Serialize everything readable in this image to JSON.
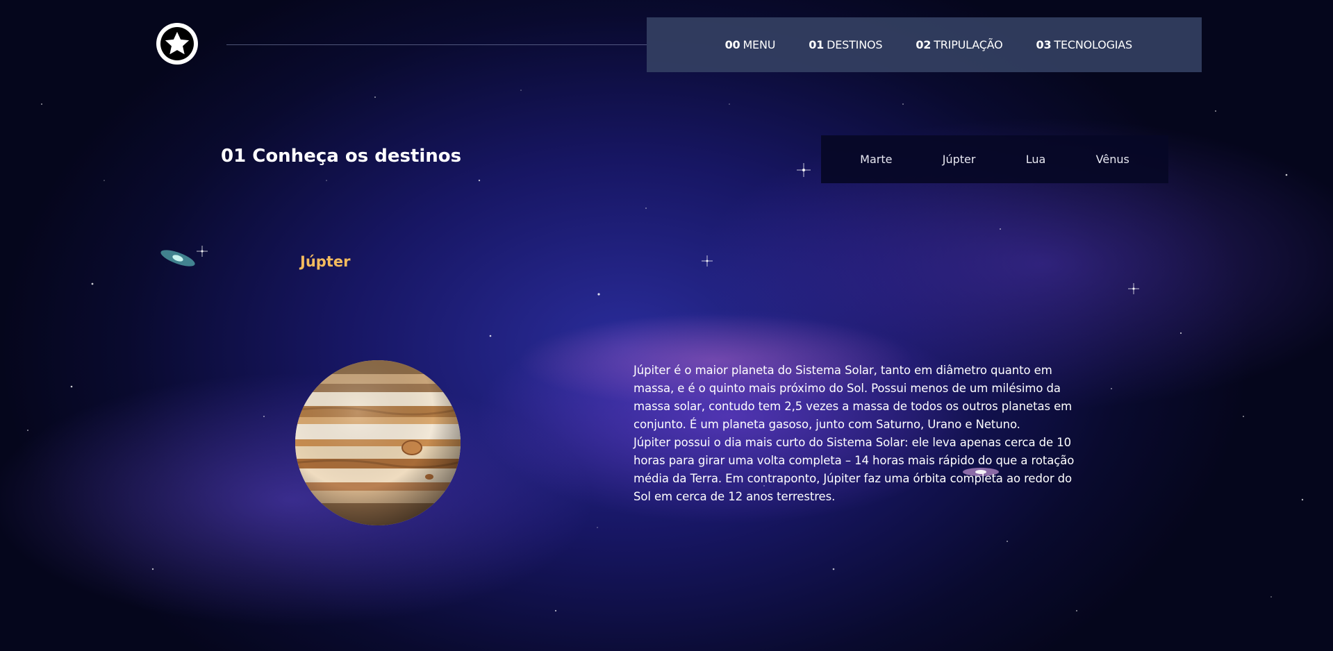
{
  "logo": {
    "icon": "star-icon"
  },
  "nav": {
    "items": [
      {
        "num": "00",
        "label": "MENU"
      },
      {
        "num": "01",
        "label": "DESTINOS"
      },
      {
        "num": "02",
        "label": "TRIPULAÇÃO"
      },
      {
        "num": "03",
        "label": "TECNOLOGIAS"
      }
    ]
  },
  "section": {
    "title": "01 Conheça os destinos"
  },
  "destinations": {
    "tabs": [
      "Marte",
      "Júpter",
      "Lua",
      "Vênus"
    ]
  },
  "planet": {
    "name": "Júpter",
    "description": [
      "Júpiter é o maior planeta do Sistema Solar, tanto em diâmetro quanto em massa, e é o quinto mais próximo do Sol. Possui menos de um milésimo da massa solar, contudo tem 2,5 vezes a massa de todos os outros planetas em conjunto. É um planeta gasoso, junto com Saturno, Urano e Netuno.",
      "Júpiter possui o dia mais curto do Sistema Solar: ele leva apenas cerca de 10 horas para girar uma volta completa – 14 horas mais rápido do que a rotação média da Terra. Em contraponto, Júpiter faz uma órbita completa ao redor do Sol em cerca de 12 anos terrestres."
    ]
  },
  "colors": {
    "accent": "#f3bb5e",
    "nav_bg": "#364264",
    "tabs_bg": "#06082a"
  }
}
